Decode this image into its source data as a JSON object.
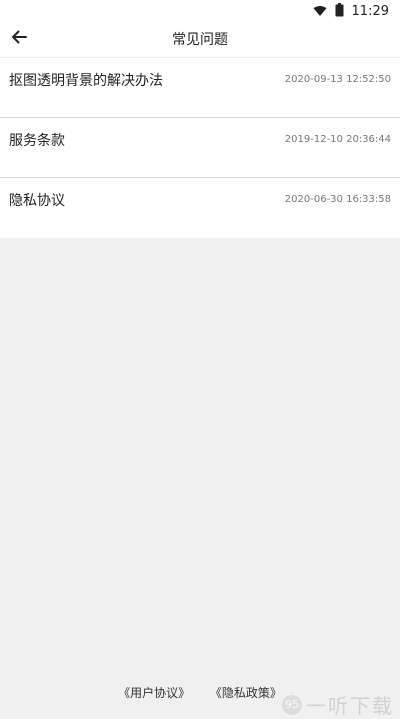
{
  "status_bar": {
    "time": "11:29",
    "icons": [
      "wifi-icon",
      "battery-icon"
    ]
  },
  "header": {
    "back_icon": "arrow-left-icon",
    "title": "常见问题"
  },
  "faq": {
    "items": [
      {
        "title": "抠图透明背景的解决办法",
        "date": "2020-09-13 12:52:50"
      },
      {
        "title": "服务条款",
        "date": "2019-12-10 20:36:44"
      },
      {
        "title": "隐私协议",
        "date": "2020-06-30 16:33:58"
      }
    ]
  },
  "footer": {
    "user_agreement": "《用户协议》",
    "privacy_policy": "《隐私政策》"
  },
  "watermark": {
    "logo_text": "95",
    "text": "一听下载"
  },
  "colors": {
    "background": "#f0f0f0",
    "surface": "#ffffff",
    "divider": "#d8d8d8",
    "primary_text": "#222222",
    "secondary_text": "#777777"
  }
}
